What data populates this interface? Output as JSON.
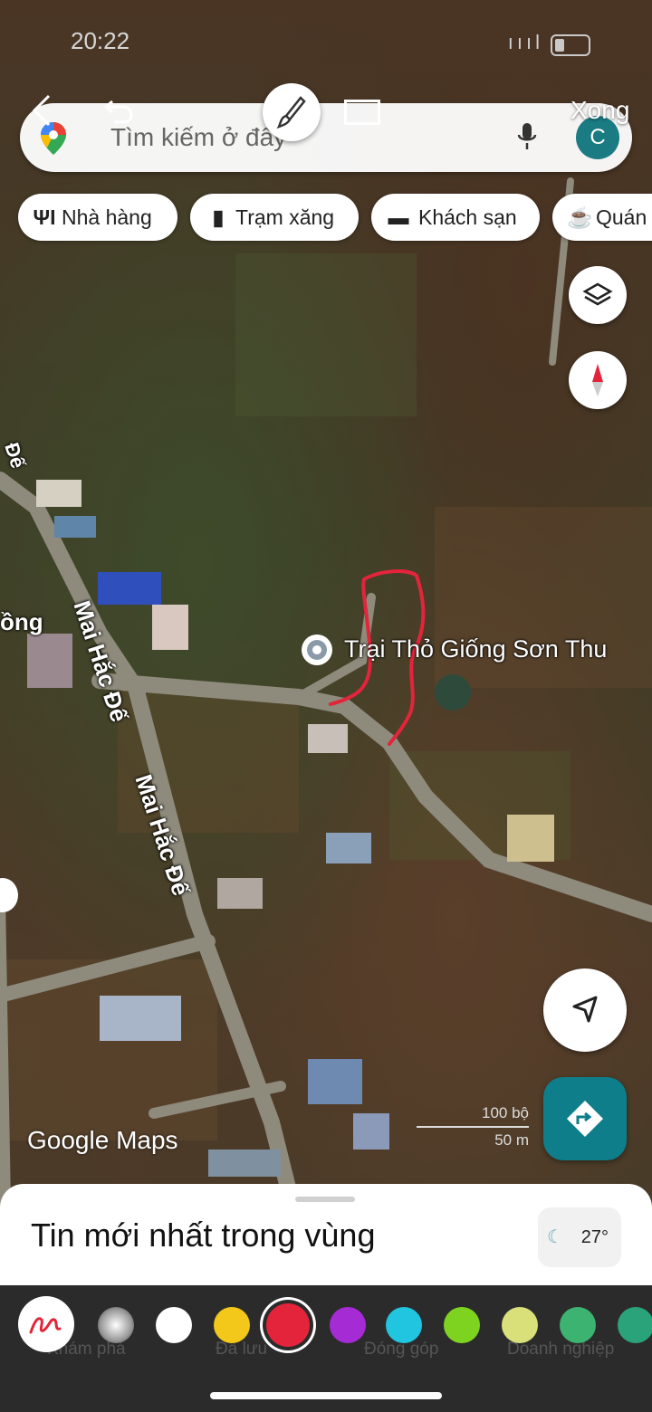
{
  "status_bar": {
    "time": "20:22",
    "signal": "ıııl"
  },
  "toolbar": {
    "back_icon": "chevron-left-icon",
    "undo_icon": "undo-icon",
    "brush_icon": "brush-icon",
    "rect_icon": "rectangle-icon",
    "done_label": "Xong"
  },
  "search": {
    "placeholder": "Tìm kiếm ở đây",
    "avatar_letter": "C"
  },
  "chips": [
    {
      "label": "Nhà hàng",
      "icon": "restaurant-icon"
    },
    {
      "label": "Trạm xăng",
      "icon": "gas-station-icon"
    },
    {
      "label": "Khách sạn",
      "icon": "hotel-icon"
    },
    {
      "label": "Quán",
      "icon": "cafe-icon"
    }
  ],
  "map": {
    "place_name": "Trại Thỏ Giống Sơn Thu",
    "roads": [
      "Mai Hắc Đế",
      "Mai Hắc Đế",
      "ồng",
      "Đế"
    ],
    "watermark": "Google Maps",
    "scale": {
      "imperial": "100 bộ",
      "metric": "50 m"
    },
    "drawing_color": "#e3243b"
  },
  "sheet": {
    "title": "Tin mới nhất trong vùng",
    "temperature": "27°"
  },
  "nav": [
    "Khám phá",
    "Đã lưu",
    "Đóng góp",
    "Doanh nghiệp"
  ],
  "palette": {
    "colors": [
      "#bdbdbd",
      "#ffffff",
      "#f4c81a",
      "#e3243b",
      "#a52bd4",
      "#22c5e0",
      "#7ed321",
      "#d9e07a",
      "#3cb371",
      "#2aa37a"
    ],
    "selected": "#e3243b"
  }
}
